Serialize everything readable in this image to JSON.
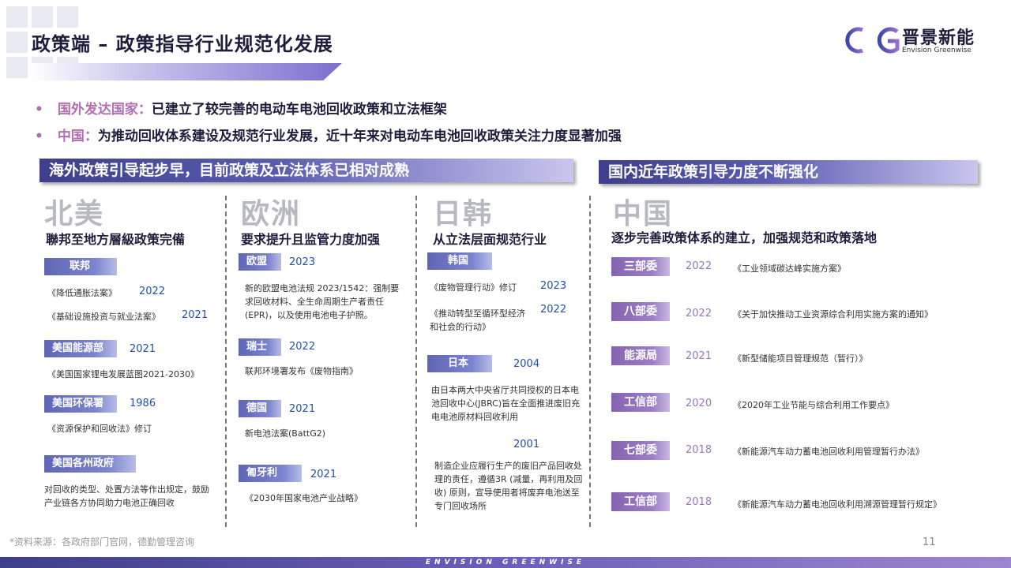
{
  "header": {
    "title": "政策端 – 政策指导行业规范化发展",
    "logo_name": "晋景新能",
    "logo_sub": "Envision Greenwise"
  },
  "bullets": [
    {
      "key": "国外发达国家：",
      "text": "已建立了较完善的电动车电池回收政策和立法框架"
    },
    {
      "key": "中国：",
      "text": "为推动回收体系建设及规范行业发展，近十年来对电动车电池回收政策关注力度显著加强"
    }
  ],
  "banners": {
    "overseas": "海外政策引导起步早，目前政策及立法体系已相对成熟",
    "domestic": "国内近年政策引导力度不断强化"
  },
  "north_america": {
    "region": "北美",
    "subtitle": "聯邦至地方層級政策完備",
    "federal_tag": "联邦",
    "federal_items": [
      {
        "name": "《降低通胀法案》",
        "year": "2022"
      },
      {
        "name": "《基础设施投资与就业法案》",
        "year": "2021"
      }
    ],
    "doe_tag": "美国能源部",
    "doe_year": "2021",
    "doe_item": "《美国国家锂电发展蓝图2021-2030》",
    "epa_tag": "美国环保署",
    "epa_year": "1986",
    "epa_item": "《资源保护和回收法》修订",
    "state_tag": "美国各州政府",
    "state_text": "对回收的类型、处置方法等作出规定，鼓励产业链各方协同助力电池正确回收"
  },
  "europe": {
    "region": "欧洲",
    "subtitle": "要求提升且监管力度加强",
    "eu_tag": "欧盟",
    "eu_year": "2023",
    "eu_text": "新的欧盟电池法规 2023/1542：强制要求回收材料、全生命周期生产者责任 (EPR)，以及使用电池电子护照。",
    "ch_tag": "瑞士",
    "ch_year": "2022",
    "ch_text": "联邦环境署发布《废物指南》",
    "de_tag": "德国",
    "de_year": "2021",
    "de_text": "新电池法案(BattG2)",
    "pt_tag": "匍牙利",
    "pt_year": "2021",
    "pt_text": "《2030年国家电池产业战略》"
  },
  "japan_korea": {
    "region": "日韩",
    "subtitle": "从立法层面规范行业",
    "kr_tag": "韩国",
    "kr_items": [
      {
        "name": "《废物管理行动》修订",
        "year": "2023"
      },
      {
        "name": "《推动转型至循环型经济和社会的行动》",
        "year": "2022"
      }
    ],
    "jp_tag": "日本",
    "jp_year_1": "2004",
    "jp_text_1": "由日本两大中央省厅共同授权的日本电池回收中心(JBRC)旨在全面推进废旧充电电池原材料回收利用",
    "jp_year_2": "2001",
    "jp_text_2": "制造企业应履行生产的废旧产品回收处理的责任，遵循3R (减量，再利用及回收) 原则，宣导使用者将废弃电池送至专门回收场所"
  },
  "china": {
    "region": "中国",
    "subtitle": "逐步完善政策体系的建立，加强规范和政策落地",
    "rows": [
      {
        "tag": "三部委",
        "year": "2022",
        "doc": "《工业领域碳达峰实施方案》"
      },
      {
        "tag": "八部委",
        "year": "2022",
        "doc": "《关于加快推动工业资源综合利用实施方案的通知》"
      },
      {
        "tag": "能源局",
        "year": "2021",
        "doc": "《新型储能项目管理规范（暂行）》"
      },
      {
        "tag": "工信部",
        "year": "2020",
        "doc": "《2020年工业节能与综合利用工作要点》"
      },
      {
        "tag": "七部委",
        "year": "2018",
        "doc": "《新能源汽车动力蓄电池回收利用管理暂行办法》"
      },
      {
        "tag": "工信部",
        "year": "2018",
        "doc": "《新能源汽车动力蓄电池回收利用溯源管理暂行规定》"
      }
    ]
  },
  "footer": {
    "source": "*资料来源：各政府部门官网，德勤管理咨询",
    "page": "11",
    "brand": "ENVISION GREENWISE"
  },
  "colors": {
    "accent_purple": "#b06fb0",
    "navy": "#1e1e3c",
    "year_blue": "#2450a8",
    "china_purple": "#9678bd"
  }
}
